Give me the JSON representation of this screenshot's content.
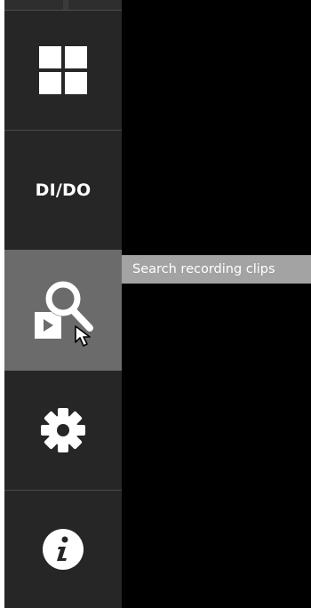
{
  "sidebar": {
    "items": [
      {
        "icon": "grid-layout-icon",
        "label": ""
      },
      {
        "icon": "",
        "label": "DI/DO"
      },
      {
        "icon": "search-recording-icon",
        "label": "",
        "active": true
      },
      {
        "icon": "gear-icon",
        "label": ""
      },
      {
        "icon": "info-icon",
        "label": ""
      }
    ]
  },
  "tooltip": {
    "text": "Search recording clips"
  },
  "colors": {
    "sidebar_bg": "#262626",
    "active_bg": "#6b6b6b",
    "tooltip_bg": "#a3a3a3",
    "icon": "#ffffff",
    "background": "#000000"
  }
}
